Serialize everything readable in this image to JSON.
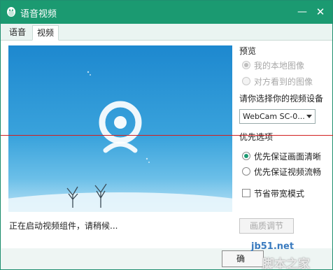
{
  "window": {
    "title": "语音视频",
    "minimize_icon": "minimize-icon",
    "close_icon": "close-icon"
  },
  "tabs": [
    {
      "label": "语音",
      "active": false
    },
    {
      "label": "视频",
      "active": true
    }
  ],
  "preview": {
    "camera_icon": "webcam-icon",
    "status_text": "正在启动视频组件，请稍候..."
  },
  "preview_group": {
    "heading": "预览",
    "options": [
      {
        "label": "我的本地图像",
        "checked": true,
        "disabled": true
      },
      {
        "label": "对方看到的图像",
        "checked": false,
        "disabled": true
      }
    ]
  },
  "device": {
    "label": "请你选择你的视频设备",
    "selected": "WebCam SC-0..."
  },
  "priority_group": {
    "heading": "优先选项",
    "options": [
      {
        "label": "优先保证画面清晰",
        "checked": true
      },
      {
        "label": "优先保证视频流畅",
        "checked": false
      }
    ]
  },
  "bandwidth": {
    "label": "节省带宽模式",
    "checked": false
  },
  "quality_button": {
    "label": "画质调节",
    "disabled": true
  },
  "footer": {
    "button_label": "确"
  },
  "watermark": {
    "line1": "jb51.net",
    "line2": "脚本之家"
  },
  "colors": {
    "titlebar": "#1b9a71",
    "accent": "#1b9a71",
    "overlay_line": "#d21f1f"
  }
}
